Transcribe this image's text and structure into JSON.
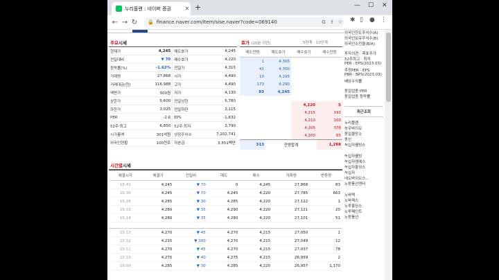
{
  "browser": {
    "tab_title": "누리플랜 : 네이버 증권",
    "url": "finance.naver.com/item/sise.naver?code=069140"
  },
  "quote": {
    "title_hl": "주요",
    "title_rest": "시세",
    "left": [
      {
        "label": "현재가",
        "value": "4,245",
        "color": "#222",
        "bold": true
      },
      {
        "label": "전일대비",
        "value": "▼ 70",
        "color": "#1e5fc3",
        "bold": true
      },
      {
        "label": "등락률(%)",
        "value": "-1.62%",
        "color": "#1e5fc3",
        "bold": true
      },
      {
        "label": "거래량",
        "value": "27,868",
        "color": "#222"
      },
      {
        "label": "거래대금(천)",
        "value": "116,988",
        "color": "#222"
      },
      {
        "label": "액면가",
        "value": "500원",
        "color": "#222"
      },
      {
        "label": "상한가",
        "value": "5,600",
        "color": "#222"
      },
      {
        "label": "하한가",
        "value": "3,025",
        "color": "#222"
      },
      {
        "label": "PER",
        "value": "-2.6",
        "color": "#222"
      },
      {
        "label": "52주 최고",
        "value": "6,850",
        "color": "#222"
      },
      {
        "label": "시가총액",
        "value": "301억원",
        "color": "#222"
      },
      {
        "label": "외국인현황",
        "value": "100천주",
        "color": "#222"
      }
    ],
    "right": [
      {
        "label": "매도호가",
        "value": "4,245"
      },
      {
        "label": "매수호가",
        "value": "4,220"
      },
      {
        "label": "전일가",
        "value": "4,315"
      },
      {
        "label": "시가",
        "value": "4,490"
      },
      {
        "label": "고가",
        "value": "4,490"
      },
      {
        "label": "저가",
        "value": "4,130"
      },
      {
        "label": "전일상한",
        "value": "5,780"
      },
      {
        "label": "전일하한",
        "value": "3,115"
      },
      {
        "label": "EPS",
        "value": "-1,632"
      },
      {
        "label": "52주 최저",
        "value": "3,790"
      },
      {
        "label": "상장주식수",
        "value": "7,102,741"
      },
      {
        "label": "자본금",
        "value": "3,551백만"
      }
    ]
  },
  "orderbook": {
    "title_hl": "호가",
    "title_rest": "(20분 지연)",
    "link_left": "5단계",
    "link_right": "10단계",
    "headers": [
      "매도잔량",
      "매도호가",
      "매수호가",
      "매수잔량"
    ],
    "sell": [
      {
        "qty": "1",
        "price": "4,305"
      },
      {
        "qty": "41",
        "price": "4,300"
      },
      {
        "qty": "10",
        "price": "4,295"
      },
      {
        "qty": "173",
        "price": "4,290"
      },
      {
        "qty": "83",
        "price": "4,245"
      }
    ],
    "buy": [
      {
        "price": "4,220",
        "qty": "5"
      },
      {
        "price": "4,215",
        "qty": "192"
      },
      {
        "price": "4,210",
        "qty": "100"
      },
      {
        "price": "4,205",
        "qty": "378"
      },
      {
        "price": "4,200",
        "qty": "65"
      }
    ],
    "total_sell": "313",
    "total_label": "잔량합계",
    "total_buy": "1,268"
  },
  "trades": {
    "title_hl": "시간별",
    "title_rest": "시세",
    "headers": [
      "체결시각",
      "체결가",
      "전일비",
      "매도",
      "매수",
      "거래량",
      "변동량"
    ],
    "rows": [
      [
        "15:41",
        "4,245",
        "▼ 70",
        "0",
        "4,245",
        "27,868",
        "83"
      ],
      [
        "15:30",
        "4,245",
        "▼ 70",
        "4,245",
        "4,220",
        "27,785",
        "663"
      ],
      [
        "15:16",
        "4,285",
        "▼ 30",
        "4,285",
        "4,220",
        "27,122",
        "1"
      ],
      [
        "15:15",
        "4,280",
        "▼ 35",
        "4,290",
        "4,220",
        "27,121",
        "20"
      ],
      [
        "15:14",
        "4,280",
        "▼ 35",
        "4,280",
        "4,220",
        "27,101",
        "51"
      ],
      null,
      [
        "15:13",
        "4,270",
        "▼ 45",
        "4,270",
        "4,215",
        "27,050",
        "1"
      ],
      [
        "15:12",
        "4,215",
        "▼ 100",
        "4,270",
        "4,215",
        "27,049",
        "12"
      ],
      [
        "15:11",
        "4,270",
        "▼ 45",
        "4,270",
        "4,215",
        "27,037",
        "78"
      ],
      [
        "15:10",
        "4,275",
        "▼ 40",
        "4,275",
        "4,215",
        "26,959",
        "2"
      ],
      [
        "15:09",
        "4,285",
        "▼ 30",
        "4,285",
        "4,220",
        "26,957",
        "1,170"
      ]
    ]
  },
  "sidebar": {
    "top": [
      "외국인한도주식수(A)",
      "외국인보유주식수(B)",
      "외국인소진율(B/A)"
    ],
    "mid": [
      "투자의견 · 목표주가",
      "52주최고 · 최저",
      "PER · EPS(2023.03)",
      "추정PER · EPS",
      "PBR · BPS(2023.03)",
      "배당수익률"
    ],
    "mid2": [
      "동일업종 PER",
      "동일업종 등락률"
    ],
    "recent_title": "최근조회",
    "recent": [
      "누리플랜",
      "농우바이오",
      "동일물망소",
      "동신",
      "녹십자웰빙스",
      "",
      "녹십자웰빙",
      "녹십자엠에스",
      "녹십자홀딩스",
      "녹십자",
      "네오바이오스...",
      "노랑풍선엔터",
      "",
      "노바텍",
      "노바렉스",
      "노루홀딩스",
      "노루페인트",
      "노랑풍선"
    ]
  }
}
